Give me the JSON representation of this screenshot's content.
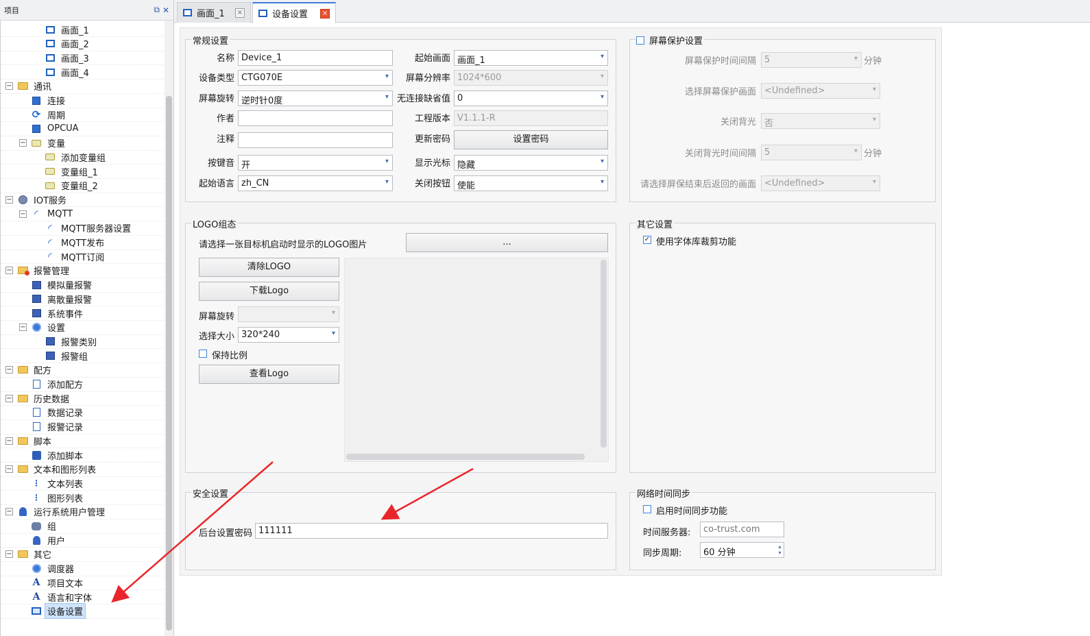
{
  "panel": {
    "title": "项目",
    "restore_icon": "restore-icon",
    "close_icon": "close-icon"
  },
  "tree": [
    {
      "label": "画面_1",
      "icon": "screen-icon",
      "level": 3,
      "expander": ""
    },
    {
      "label": "画面_2",
      "icon": "screen-icon",
      "level": 3,
      "expander": ""
    },
    {
      "label": "画面_3",
      "icon": "screen-icon",
      "level": 3,
      "expander": ""
    },
    {
      "label": "画面_4",
      "icon": "screen-icon",
      "level": 3,
      "expander": ""
    },
    {
      "label": "通讯",
      "icon": "folder-icon",
      "level": 1,
      "expander": "−"
    },
    {
      "label": "连接",
      "icon": "connection-icon",
      "level": 2,
      "expander": ""
    },
    {
      "label": "周期",
      "icon": "cycle-icon",
      "level": 2,
      "expander": ""
    },
    {
      "label": "OPCUA",
      "icon": "connection-icon",
      "level": 2,
      "expander": ""
    },
    {
      "label": "变量",
      "icon": "variable-icon",
      "level": 2,
      "expander": "−"
    },
    {
      "label": "添加变量组",
      "icon": "variable-icon",
      "level": 3,
      "expander": ""
    },
    {
      "label": "变量组_1",
      "icon": "variable-icon",
      "level": 3,
      "expander": ""
    },
    {
      "label": "变量组_2",
      "icon": "variable-icon",
      "level": 3,
      "expander": ""
    },
    {
      "label": "IOT服务",
      "icon": "iot-icon",
      "level": 1,
      "expander": "−"
    },
    {
      "label": "MQTT",
      "icon": "wifi-icon",
      "level": 2,
      "expander": "−"
    },
    {
      "label": "MQTT服务器设置",
      "icon": "wifi-icon",
      "level": 3,
      "expander": ""
    },
    {
      "label": "MQTT发布",
      "icon": "wifi-icon",
      "level": 3,
      "expander": ""
    },
    {
      "label": "MQTT订阅",
      "icon": "wifi-icon",
      "level": 3,
      "expander": ""
    },
    {
      "label": "报警管理",
      "icon": "alarm-folder-icon",
      "level": 1,
      "expander": "−"
    },
    {
      "label": "模拟量报警",
      "icon": "alarm-icon",
      "level": 2,
      "expander": ""
    },
    {
      "label": "离散量报警",
      "icon": "alarm-icon",
      "level": 2,
      "expander": ""
    },
    {
      "label": "系统事件",
      "icon": "alarm-icon",
      "level": 2,
      "expander": ""
    },
    {
      "label": "设置",
      "icon": "gear-icon",
      "level": 2,
      "expander": "−"
    },
    {
      "label": "报警类别",
      "icon": "alarm-icon",
      "level": 3,
      "expander": ""
    },
    {
      "label": "报警组",
      "icon": "alarm-icon",
      "level": 3,
      "expander": ""
    },
    {
      "label": "配方",
      "icon": "folder-icon",
      "level": 1,
      "expander": "−"
    },
    {
      "label": "添加配方",
      "icon": "document-icon",
      "level": 2,
      "expander": ""
    },
    {
      "label": "历史数据",
      "icon": "folder-icon",
      "level": 1,
      "expander": "−"
    },
    {
      "label": "数据记录",
      "icon": "document-icon",
      "level": 2,
      "expander": ""
    },
    {
      "label": "报警记录",
      "icon": "document-icon",
      "level": 2,
      "expander": ""
    },
    {
      "label": "脚本",
      "icon": "folder-icon",
      "level": 1,
      "expander": "−"
    },
    {
      "label": "添加脚本",
      "icon": "script-icon",
      "level": 2,
      "expander": ""
    },
    {
      "label": "文本和图形列表",
      "icon": "folder-icon",
      "level": 1,
      "expander": "−"
    },
    {
      "label": "文本列表",
      "icon": "list-icon",
      "level": 2,
      "expander": ""
    },
    {
      "label": "图形列表",
      "icon": "list-icon",
      "level": 2,
      "expander": ""
    },
    {
      "label": "运行系统用户管理",
      "icon": "user-icon",
      "level": 1,
      "expander": "−"
    },
    {
      "label": "组",
      "icon": "group-icon",
      "level": 2,
      "expander": ""
    },
    {
      "label": "用户",
      "icon": "user-icon",
      "level": 2,
      "expander": ""
    },
    {
      "label": "其它",
      "icon": "folder-icon",
      "level": 1,
      "expander": "−"
    },
    {
      "label": "调度器",
      "icon": "gear-icon",
      "level": 2,
      "expander": ""
    },
    {
      "label": "项目文本",
      "icon": "text-icon",
      "level": 2,
      "expander": ""
    },
    {
      "label": "语言和字体",
      "icon": "text-icon",
      "level": 2,
      "expander": ""
    },
    {
      "label": "设备设置",
      "icon": "device-icon",
      "level": 2,
      "expander": "",
      "selected": true
    }
  ],
  "tabs": [
    {
      "label": "画面_1",
      "close": "×"
    },
    {
      "label": "设备设置",
      "close": "×"
    }
  ],
  "general": {
    "title": "常规设置",
    "name_label": "名称",
    "name_value": "Device_1",
    "device_type_label": "设备类型",
    "device_type_value": "CTG070E",
    "rotation_label": "屏幕旋转",
    "rotation_value": "逆时针0度",
    "author_label": "作者",
    "author_value": "",
    "comment_label": "注释",
    "comment_value": "",
    "keysound_label": "按键音",
    "keysound_value": "开",
    "language_label": "起始语言",
    "language_value": "zh_CN",
    "start_screen_label": "起始画面",
    "start_screen_value": "画面_1",
    "resolution_label": "屏幕分辨率",
    "resolution_value": "1024*600",
    "no_conn_label": "无连接缺省值",
    "no_conn_value": "0",
    "version_label": "工程版本",
    "version_value": "V1.1.1-R",
    "update_pwd_label": "更新密码",
    "set_pwd_button": "设置密码",
    "cursor_label": "显示光标",
    "cursor_value": "隐藏",
    "close_button_label": "关闭按钮",
    "close_button_value": "使能"
  },
  "screensaver": {
    "title": "屏幕保护设置",
    "interval_label": "屏幕保护时间间隔",
    "interval_value": "5",
    "interval_unit": "分钟",
    "screen_label": "选择屏幕保护画面",
    "screen_value": "<Undefined>",
    "backlight_label": "关闭背光",
    "backlight_value": "否",
    "backlight_interval_label": "关闭背光时间间隔",
    "backlight_interval_value": "5",
    "backlight_interval_unit": "分钟",
    "return_label": "请选择屏保结束后返回的画面",
    "return_value": "<Undefined>"
  },
  "logo": {
    "title": "LOGO组态",
    "select_label": "请选择一张目标机启动时显示的LOGO图片",
    "browse_button": "...",
    "clear_button": "清除LOGO",
    "download_button": "下载Logo",
    "rotation_label": "屏幕旋转",
    "rotation_value": "",
    "size_label": "选择大小",
    "size_value": "320*240",
    "keep_ratio_label": "保持比例",
    "view_button": "查看Logo"
  },
  "other": {
    "title": "其它设置",
    "font_clip_label": "使用字体库裁剪功能",
    "font_clip_check": "✓"
  },
  "security": {
    "title": "安全设置",
    "pwd_label": "后台设置密码",
    "pwd_value": "111111"
  },
  "ntp": {
    "title": "网络时间同步",
    "enable_label": "启用时间同步功能",
    "server_label": "时间服务器:",
    "server_placeholder": "co-trust.com",
    "period_label": "同步周期:",
    "period_value": "60 分钟"
  },
  "colors": {
    "accent": "#3b7ad9",
    "arrow": "#e8262a",
    "selection": "#cfe3fb"
  }
}
